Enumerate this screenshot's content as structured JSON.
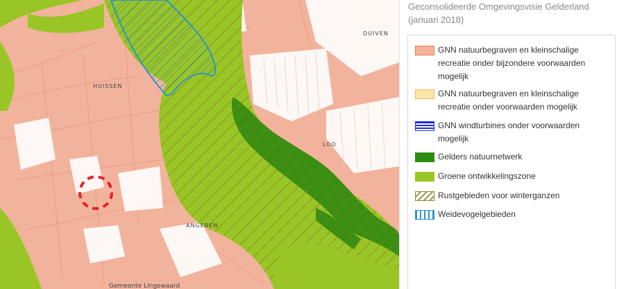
{
  "map": {
    "places": [
      {
        "name": "HUISSEN"
      },
      {
        "name": "DUIVEN"
      },
      {
        "name": "LOO"
      },
      {
        "name": "ANGEREN"
      },
      {
        "name": "Gemeente Lingewaard"
      }
    ],
    "colors": {
      "urban": "#f2b39c",
      "green_zone": "#9ac526",
      "nature_network": "#3a8f12",
      "winter_geese": "#8c8c2c",
      "meadow_bird": "#2c95c8"
    },
    "marker": {
      "icon": "dashed-circle-marker",
      "color": "#e8202a"
    }
  },
  "legend": {
    "title": [
      "Geconsolideerde Omgevingsvisie Gelderland",
      "(januari 2018)"
    ],
    "items": [
      {
        "label": [
          "GNN natuurbegraven en kleinschalige",
          "recreatie onder bijzondere voorwaarden",
          "mogelijk"
        ],
        "fill": "#f8b29a",
        "border": "#e07b5d",
        "pattern": "solid"
      },
      {
        "label": [
          "GNN natuurbegraven en kleinschalige",
          "recreatie onder voorwaarden mogelijk"
        ],
        "fill": "#fde6a8",
        "border": "#e6b866",
        "pattern": "solid"
      },
      {
        "label": [
          "GNN windturbines onder voorwaarden",
          "mogelijk"
        ],
        "fill": "#1f2bd6",
        "border": "#1f2bd6",
        "pattern": "horizontal-lines"
      },
      {
        "label": [
          "Gelders natuurnetwerk"
        ],
        "fill": "#2e8b10",
        "border": "#2e8b10",
        "pattern": "solid"
      },
      {
        "label": [
          "Groene ontwikkelingszone"
        ],
        "fill": "#9ac526",
        "border": "#9ac526",
        "pattern": "solid"
      },
      {
        "label": [
          "Rustgebieden voor winterganzen"
        ],
        "fill": "#8c8c2c",
        "border": "#8c8c2c",
        "pattern": "diagonal-lines"
      },
      {
        "label": [
          "Weidevogelgebieden"
        ],
        "fill": "#2c95c8",
        "border": "#2c95c8",
        "pattern": "vertical-lines"
      }
    ]
  }
}
